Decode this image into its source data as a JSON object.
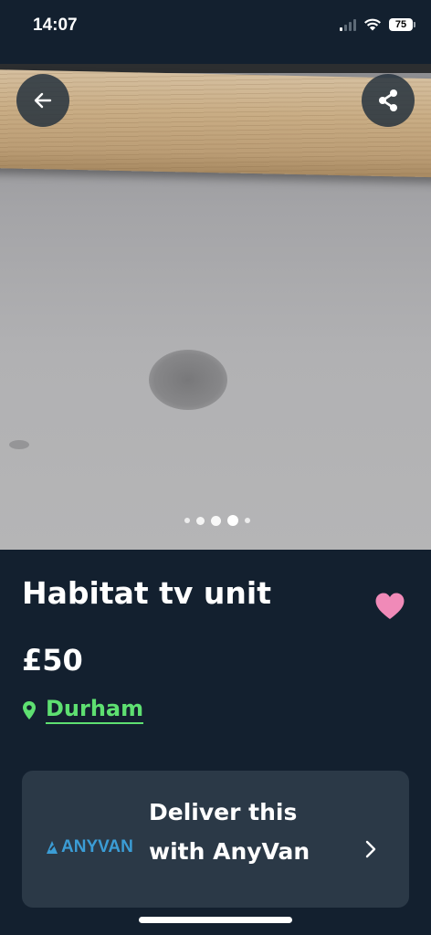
{
  "status_bar": {
    "time": "14:07",
    "battery": "75"
  },
  "listing": {
    "title": "Habitat tv unit",
    "price": "£50",
    "location": "Durham",
    "photo_count": 5,
    "current_photo": 4
  },
  "delivery": {
    "logo_text": "ANYVAN",
    "text": "Deliver this with AnyVan"
  },
  "icons": {
    "back": "arrow-left-icon",
    "share": "share-icon",
    "favorite": "heart-icon",
    "location": "map-pin-icon",
    "chevron": "chevron-right-icon"
  },
  "colors": {
    "background": "#13202f",
    "card": "#2b3947",
    "location_green": "#5ee071",
    "heart_pink": "#f08ab8",
    "anyvan_blue": "#3b9dd6"
  }
}
